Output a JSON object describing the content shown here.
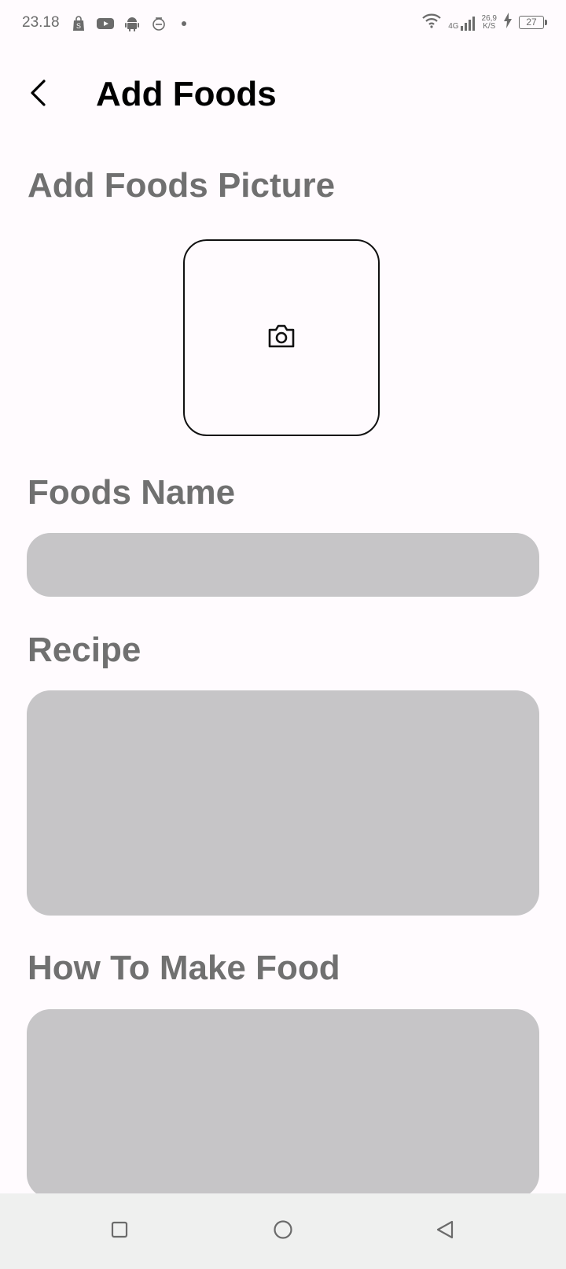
{
  "status_bar": {
    "time": "23.18",
    "network_type": "4G",
    "speed_value": "26,9",
    "speed_unit": "K/S",
    "battery_level": "27"
  },
  "header": {
    "title": "Add Foods"
  },
  "form": {
    "picture_label": "Add Foods Picture",
    "name_label": "Foods Name",
    "name_value": "",
    "recipe_label": "Recipe",
    "recipe_value": "",
    "howto_label": "How To Make Food",
    "howto_value": ""
  },
  "icons": {
    "back": "chevron-left-icon",
    "photo": "camera-icon",
    "nav_recent": "square-icon",
    "nav_home": "circle-icon",
    "nav_back": "triangle-left-icon"
  },
  "colors": {
    "background": "#fffbfe",
    "label": "#707070",
    "field_fill": "#c6c5c7",
    "nav_bar": "#eff0ef"
  }
}
